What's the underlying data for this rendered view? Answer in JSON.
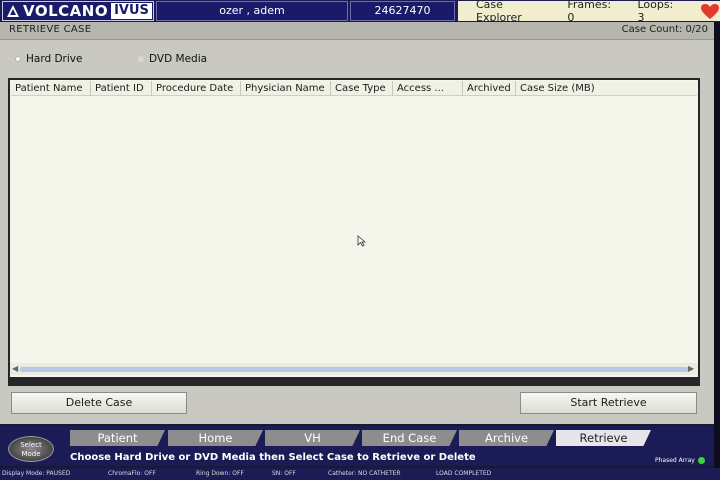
{
  "header": {
    "brand": "VOLCANO",
    "brand_suffix": "IVUS",
    "user": "ozer , adem",
    "patient_id": "24627470",
    "mode": "Case Explorer",
    "frames": "Frames: 0",
    "loops": "Loops: 3",
    "heart_color": "#e23b2e"
  },
  "panel": {
    "title": "RETRIEVE CASE",
    "case_count": "Case Count: 0/20"
  },
  "source": {
    "options": [
      "Hard Drive",
      "DVD Media"
    ],
    "selected": "Hard Drive"
  },
  "table": {
    "columns": [
      "Patient Name",
      "Patient ID",
      "Procedure Date",
      "Physician Name",
      "Case Type",
      "Access ...",
      "Archived",
      "Case Size (MB)"
    ],
    "rows": []
  },
  "buttons": {
    "delete": "Delete Case",
    "retrieve": "Start Retrieve"
  },
  "nav": {
    "select_mode": [
      "Select",
      "Mode"
    ],
    "tabs": [
      "Patient",
      "Home",
      "VH",
      "End Case",
      "Archive",
      "Retrieve"
    ],
    "active_tab": "Retrieve",
    "instruction": "Choose Hard Drive or DVD Media then Select Case to Retrieve or Delete",
    "phased": "Phased Array"
  },
  "status_strip": [
    "Display Mode: PAUSED",
    "ChromaFlo: OFF",
    "Ring Down: OFF",
    "SN: OFF",
    "Catheter: NO CATHETER",
    "LOAD COMPLETED"
  ],
  "colors": {
    "navy": "#1b1b55",
    "panel": "#c9c9c2",
    "table_bg": "#f4f6ec",
    "active_tab": "#e6e6ea",
    "inactive_tab": "#8d8d8d"
  }
}
